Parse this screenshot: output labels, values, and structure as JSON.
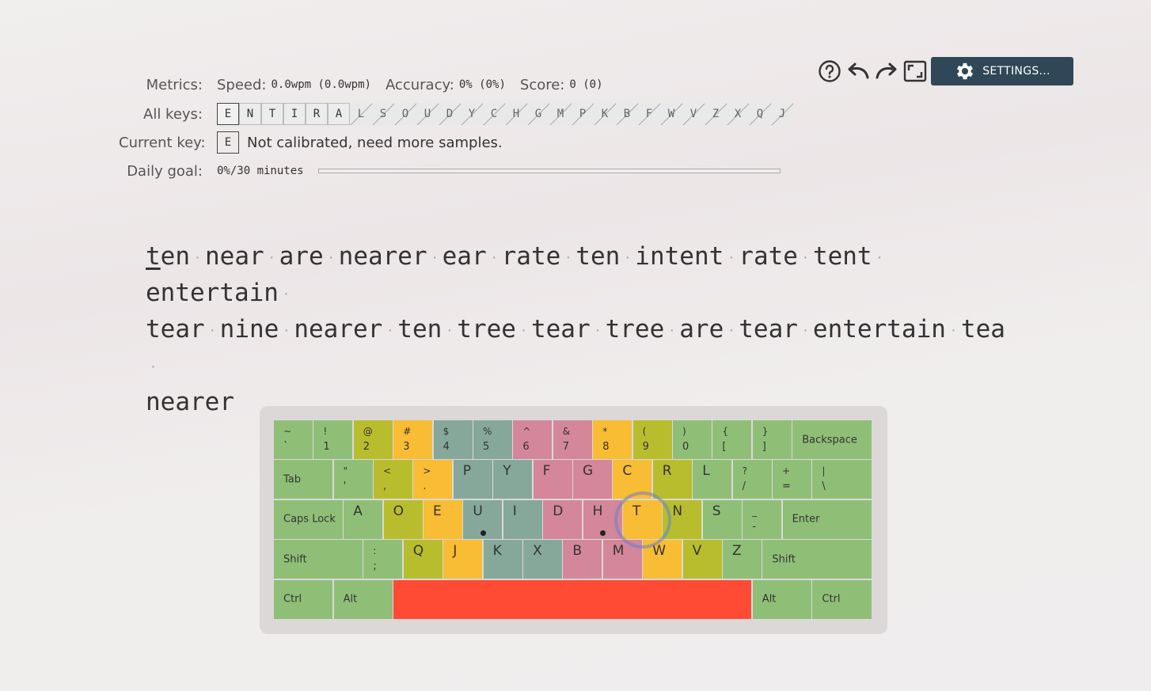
{
  "toolbar": {
    "help_icon": "help-circle-icon",
    "undo_icon": "undo-icon",
    "redo_icon": "redo-icon",
    "fullscreen_icon": "fullscreen-icon",
    "settings_label": "SETTINGS..."
  },
  "metrics": {
    "label": "Metrics:",
    "speed_name": "Speed:",
    "speed_value": "0.0wpm (0.0wpm)",
    "accuracy_name": "Accuracy:",
    "accuracy_value": "0% (0%)",
    "score_name": "Score:",
    "score_value": "0 (0)"
  },
  "all_keys": {
    "label": "All keys:",
    "unlocked": [
      "E",
      "N",
      "T",
      "I",
      "R",
      "A"
    ],
    "locked": [
      "L",
      "S",
      "O",
      "U",
      "D",
      "Y",
      "C",
      "H",
      "G",
      "M",
      "P",
      "K",
      "B",
      "F",
      "W",
      "V",
      "Z",
      "X",
      "Q",
      "J"
    ]
  },
  "current_key": {
    "label": "Current key:",
    "key": "E",
    "status": "Not calibrated, need more samples."
  },
  "daily_goal": {
    "label": "Daily goal:",
    "text": "0%/30 minutes",
    "progress_fraction": 0
  },
  "practice": {
    "words": [
      "ten",
      "near",
      "are",
      "nearer",
      "ear",
      "rate",
      "ten",
      "intent",
      "rate",
      "tent",
      "entertain",
      "tear",
      "nine",
      "nearer",
      "ten",
      "tree",
      "tear",
      "tree",
      "are",
      "tear",
      "entertain",
      "tea",
      "nearer"
    ],
    "line_breaks_after": [
      10,
      21
    ]
  },
  "keyboard": {
    "colors": {
      "green": "#8fbf77",
      "olive": "#b8bd2e",
      "orange": "#f8bc35",
      "teal": "#86a89a",
      "pink": "#d4869b",
      "red": "#ff4a34"
    },
    "rows": [
      [
        {
          "shift": "~",
          "base": "`",
          "color": "green"
        },
        {
          "shift": "!",
          "base": "1",
          "color": "green"
        },
        {
          "shift": "@",
          "base": "2",
          "color": "olive"
        },
        {
          "shift": "#",
          "base": "3",
          "color": "orange"
        },
        {
          "shift": "$",
          "base": "4",
          "color": "teal"
        },
        {
          "shift": "%",
          "base": "5",
          "color": "teal"
        },
        {
          "shift": "^",
          "base": "6",
          "color": "pink"
        },
        {
          "shift": "&",
          "base": "7",
          "color": "pink"
        },
        {
          "shift": "*",
          "base": "8",
          "color": "orange"
        },
        {
          "shift": "(",
          "base": "9",
          "color": "olive"
        },
        {
          "shift": ")",
          "base": "0",
          "color": "green"
        },
        {
          "shift": "{",
          "base": "[",
          "color": "green"
        },
        {
          "shift": "}",
          "base": "]",
          "color": "green"
        },
        {
          "label": "Backspace",
          "color": "green"
        }
      ],
      [
        {
          "label": "Tab",
          "color": "green"
        },
        {
          "shift": "\"",
          "base": "'",
          "color": "green"
        },
        {
          "shift": "<",
          "base": ",",
          "color": "olive"
        },
        {
          "shift": ">",
          "base": ".",
          "color": "orange"
        },
        {
          "big": "P",
          "color": "teal"
        },
        {
          "big": "Y",
          "color": "teal"
        },
        {
          "big": "F",
          "color": "pink"
        },
        {
          "big": "G",
          "color": "pink"
        },
        {
          "big": "C",
          "color": "orange"
        },
        {
          "big": "R",
          "color": "olive"
        },
        {
          "big": "L",
          "color": "green"
        },
        {
          "shift": "?",
          "base": "/",
          "color": "green"
        },
        {
          "shift": "+",
          "base": "=",
          "color": "green"
        },
        {
          "shift": "|",
          "base": "\\",
          "color": "green"
        }
      ],
      [
        {
          "label": "Caps Lock",
          "color": "green"
        },
        {
          "big": "A",
          "color": "green"
        },
        {
          "big": "O",
          "color": "olive"
        },
        {
          "big": "E",
          "color": "orange"
        },
        {
          "big": "U",
          "color": "teal",
          "bump": true
        },
        {
          "big": "I",
          "color": "teal"
        },
        {
          "big": "D",
          "color": "pink"
        },
        {
          "big": "H",
          "color": "pink",
          "bump": true
        },
        {
          "big": "T",
          "color": "orange"
        },
        {
          "big": "N",
          "color": "olive"
        },
        {
          "big": "S",
          "color": "green"
        },
        {
          "shift": "_",
          "base": "-",
          "color": "green"
        },
        {
          "label": "Enter",
          "color": "green"
        }
      ],
      [
        {
          "label": "Shift",
          "color": "green"
        },
        {
          "shift": ":",
          "base": ";",
          "color": "green"
        },
        {
          "big": "Q",
          "color": "olive"
        },
        {
          "big": "J",
          "color": "orange"
        },
        {
          "big": "K",
          "color": "teal"
        },
        {
          "big": "X",
          "color": "teal"
        },
        {
          "big": "B",
          "color": "pink"
        },
        {
          "big": "M",
          "color": "pink"
        },
        {
          "big": "W",
          "color": "orange"
        },
        {
          "big": "V",
          "color": "olive"
        },
        {
          "big": "Z",
          "color": "green"
        },
        {
          "label": "Shift",
          "color": "green"
        }
      ],
      [
        {
          "label": "Ctrl",
          "color": "green"
        },
        {
          "label": "Alt",
          "color": "green"
        },
        {
          "label": "",
          "color": "red"
        },
        {
          "label": "Alt",
          "color": "green"
        },
        {
          "label": "Ctrl",
          "color": "green"
        }
      ]
    ]
  }
}
